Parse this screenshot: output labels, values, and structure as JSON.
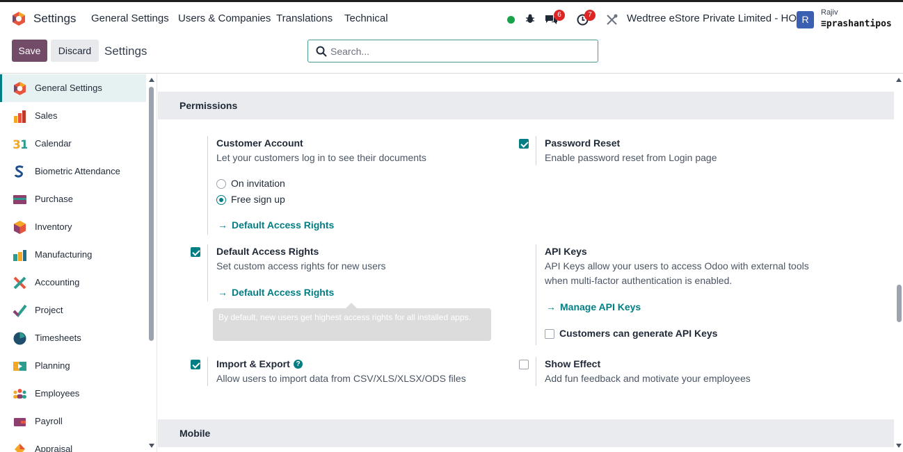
{
  "topbar": {
    "app_name": "Settings",
    "menu": [
      "General Settings",
      "Users & Companies",
      "Translations",
      "Technical"
    ],
    "chat_count": "6",
    "activity_count": "7",
    "company": "Wedtree eStore Private Limited - HO",
    "avatar_letter": "R",
    "user_name": "Rajiv",
    "database": "prashantipos",
    "status_color": "#16a34a"
  },
  "control": {
    "save_label": "Save",
    "discard_label": "Discard",
    "breadcrumb": "Settings",
    "search_placeholder": "Search..."
  },
  "sidebar": {
    "items": [
      {
        "label": "General Settings",
        "icon": "settings-hex-icon",
        "active": true
      },
      {
        "label": "Sales",
        "icon": "sales-chart-icon"
      },
      {
        "label": "Calendar",
        "icon": "calendar-31-icon"
      },
      {
        "label": "Biometric Attendance",
        "icon": "biometric-s-icon"
      },
      {
        "label": "Purchase",
        "icon": "purchase-card-icon"
      },
      {
        "label": "Inventory",
        "icon": "inventory-box-icon"
      },
      {
        "label": "Manufacturing",
        "icon": "manufacturing-factory-icon"
      },
      {
        "label": "Accounting",
        "icon": "accounting-cross-icon"
      },
      {
        "label": "Project",
        "icon": "project-check-icon"
      },
      {
        "label": "Timesheets",
        "icon": "timesheets-clock-icon"
      },
      {
        "label": "Planning",
        "icon": "planning-icon"
      },
      {
        "label": "Employees",
        "icon": "employees-group-icon"
      },
      {
        "label": "Payroll",
        "icon": "payroll-wallet-icon"
      },
      {
        "label": "Appraisal",
        "icon": "appraisal-icon"
      }
    ]
  },
  "permissions": {
    "section_title": "Permissions",
    "customer_account": {
      "title": "Customer Account",
      "desc": "Let your customers log in to see their documents",
      "options": [
        "On invitation",
        "Free sign up"
      ],
      "selected": "Free sign up",
      "link": "Default Access Rights"
    },
    "password_reset": {
      "title": "Password Reset",
      "desc": "Enable password reset from Login page",
      "checked": true
    },
    "default_access": {
      "title": "Default Access Rights",
      "desc": "Set custom access rights for new users",
      "link": "Default Access Rights",
      "checked": true,
      "tooltip": "By default, new users get highest access rights for all installed apps."
    },
    "api_keys": {
      "title": "API Keys",
      "desc_line1": "API Keys allow your users to access Odoo with external tools",
      "desc_line2": "when multi-factor authentication is enabled.",
      "link": "Manage API Keys",
      "checkbox_label": "Customers can generate API Keys",
      "customers_checked": false
    },
    "import_export": {
      "title": "Import & Export",
      "desc": "Allow users to import data from CSV/XLS/XLSX/ODS files",
      "checked": true,
      "help": "?"
    },
    "show_effect": {
      "title": "Show Effect",
      "desc": "Add fun feedback and motivate your employees",
      "checked": false
    }
  },
  "mobile": {
    "section_title": "Mobile"
  },
  "colors": {
    "brand": "#714b67",
    "accent": "#017e84"
  }
}
